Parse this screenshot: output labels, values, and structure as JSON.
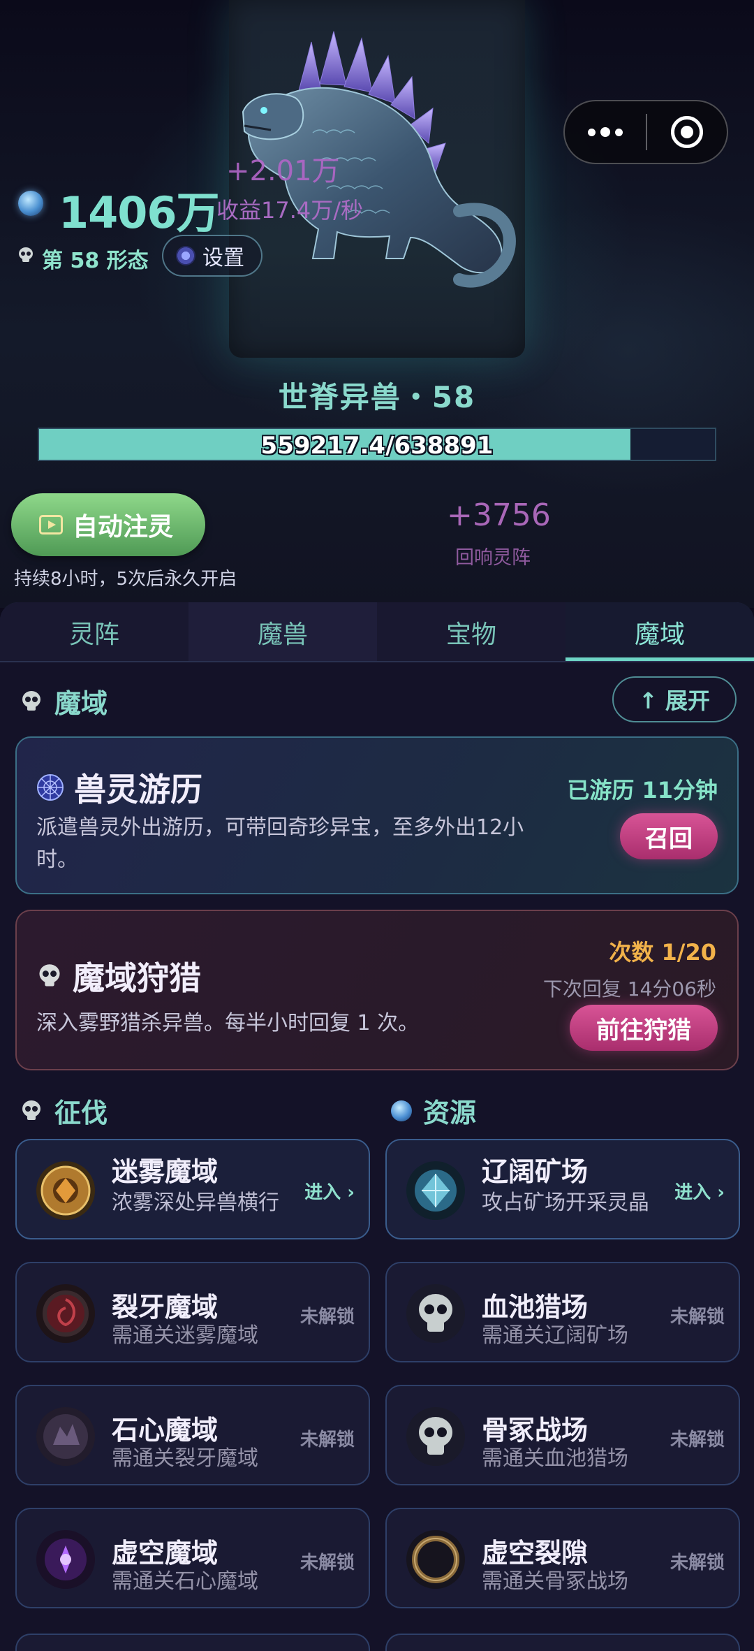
{
  "hero": {
    "coins": "1406万",
    "float_gain": "+2.01万",
    "income": "收益17.4万/秒",
    "form": "第 58 形态",
    "settings_label": "设置",
    "beast_name": "世脊异兽・58",
    "exp_text": "559217.4/638891",
    "exp_progress": 0.875,
    "auto_button": "自动注灵",
    "auto_note": "持续8小时，5次后永久开启",
    "resonance_value": "+3756",
    "resonance_label": "回响灵阵"
  },
  "tabs": [
    "灵阵",
    "魔兽",
    "宝物",
    "魔域"
  ],
  "active_tab": "魔域",
  "section": {
    "title": "魔域",
    "expand_label": "↑ 展开"
  },
  "travel": {
    "title": "兽灵游历",
    "desc": "派遣兽灵外出游历，可带回奇珍异宝，至多外出12小时。",
    "status": "已游历 11分钟",
    "button": "召回"
  },
  "hunt": {
    "title": "魔域狩猎",
    "desc": "深入雾野猎杀异兽。每半小时回复 1 次。",
    "count": "次数 1/20",
    "regen": "下次回复 14分06秒",
    "button": "前往狩猎"
  },
  "conquest": {
    "title": "征伐",
    "items": [
      {
        "name": "迷雾魔域",
        "desc": "浓雾深处异兽横行",
        "action": "进入 ›",
        "icon": "mist-realm-icon"
      },
      {
        "name": "裂牙魔域",
        "desc": "需通关迷雾魔域",
        "action": "未解锁",
        "icon": "fang-realm-icon"
      },
      {
        "name": "石心魔域",
        "desc": "需通关裂牙魔域",
        "action": "未解锁",
        "icon": "stone-realm-icon"
      },
      {
        "name": "虚空魔域",
        "desc": "需通关石心魔域",
        "action": "未解锁",
        "icon": "void-realm-icon"
      }
    ]
  },
  "resources": {
    "title": "资源",
    "items": [
      {
        "name": "辽阔矿场",
        "desc": "攻占矿场开采灵晶",
        "action": "进入 ›",
        "icon": "crystal-mine-icon"
      },
      {
        "name": "血池猎场",
        "desc": "需通关辽阔矿场",
        "action": "未解锁",
        "icon": "skull-icon"
      },
      {
        "name": "骨冢战场",
        "desc": "需通关血池猎场",
        "action": "未解锁",
        "icon": "skull-icon"
      },
      {
        "name": "虚空裂隙",
        "desc": "需通关骨冢战场",
        "action": "未解锁",
        "icon": "void-ring-icon"
      }
    ]
  },
  "colors": {
    "accent_teal": "#8ad9cc",
    "exp_fill": "#6fcfc2",
    "pink_button": "#c8437f",
    "count_gold": "#f2b24a",
    "resonance_purple": "#a967b8"
  }
}
